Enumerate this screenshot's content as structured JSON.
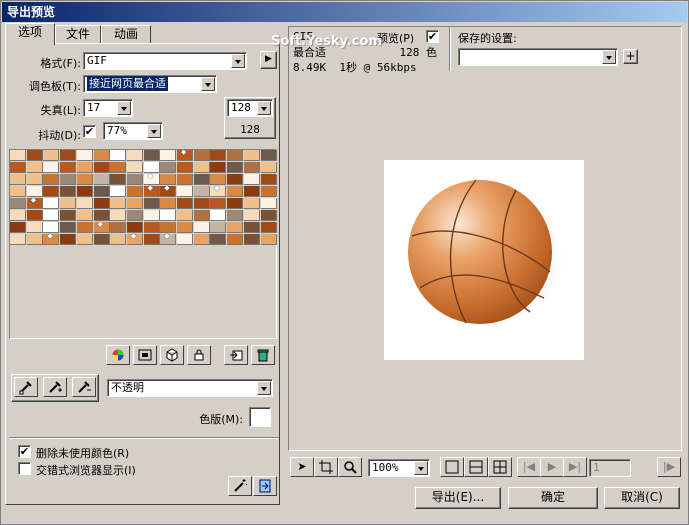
{
  "window": {
    "title": "导出预览"
  },
  "tabs": [
    {
      "label": "选项",
      "active": true
    },
    {
      "label": "文件",
      "active": false
    },
    {
      "label": "动画",
      "active": false
    }
  ],
  "options": {
    "format_label": "格式(F):",
    "format_value": "GIF",
    "palette_label": "调色板(T):",
    "palette_value": "接近网页最合适",
    "loss_label": "失真(L):",
    "loss_value": "17",
    "dither_label": "抖动(D):",
    "dither_checked": true,
    "dither_value": "77%",
    "colors_value": "128",
    "colors_count": "128",
    "transparency_value": "不透明",
    "matte_label": "色版(M):",
    "remove_unused_label": "删除未使用颜色(R)",
    "remove_unused_checked": true,
    "interlace_label": "交错式浏览器显示(I)",
    "interlace_checked": false
  },
  "preview": {
    "format": "GIF",
    "preset": "最合适",
    "filesize": "8.49K",
    "time": "1秒 @ 56kbps",
    "preview_label": "预览(P)",
    "preview_checked": true,
    "color_count": "128 色",
    "saved_settings_label": "保存的设置:",
    "saved_settings_value": "",
    "watermark": "Soft.Yesky.com"
  },
  "bottom": {
    "zoom_value": "100%",
    "frame_value": "1",
    "export_label": "导出(E)...",
    "ok_label": "确定",
    "cancel_label": "取消(C)"
  },
  "icons": {
    "palette_tools": [
      "color-wheel-icon",
      "snap-web-icon",
      "cube-icon",
      "lock-icon",
      "add-color-icon",
      "trash-icon"
    ],
    "eyedroppers": [
      "eyedropper-icon",
      "eyedropper-add-icon",
      "eyedropper-remove-icon"
    ],
    "view_tools": [
      "pointer-icon",
      "crop-icon",
      "zoom-icon"
    ],
    "view_modes": [
      "single-view-icon",
      "two-view-icon",
      "four-view-icon"
    ],
    "playback": [
      "first-frame-icon",
      "play-icon",
      "last-frame-icon",
      "next-frame-icon"
    ],
    "corner": [
      "magic-wand-icon",
      "export-wizard-icon"
    ]
  },
  "colors": {
    "titlebar": "#0a246a",
    "dialog": "#d4d0c8",
    "ball": "#d2783a"
  }
}
